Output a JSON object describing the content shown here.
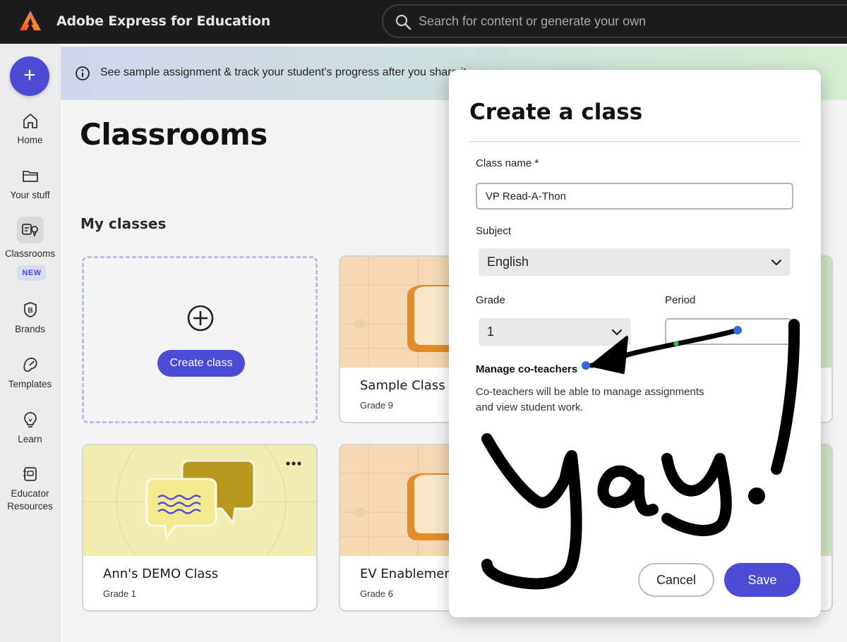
{
  "app": {
    "title": "Adobe Express for Education",
    "search_placeholder": "Search for content or generate your own"
  },
  "sidebar": {
    "create_icon": "plus-icon",
    "items": [
      {
        "label": "Home",
        "icon": "home-icon"
      },
      {
        "label": "Your stuff",
        "icon": "folder-icon"
      },
      {
        "label": "Classrooms",
        "icon": "classrooms-icon",
        "active": true
      },
      {
        "label": "Brands",
        "icon": "brand-icon"
      },
      {
        "label": "Templates",
        "icon": "templates-icon"
      },
      {
        "label": "Learn",
        "icon": "lightbulb-icon"
      },
      {
        "label": "Educator Resources",
        "icon": "resources-icon"
      }
    ],
    "new_badge": "NEW"
  },
  "banner": {
    "text": "See sample assignment & track your student's progress after you share it."
  },
  "main": {
    "title": "Classrooms",
    "section_title": "My classes",
    "create_class_label": "Create class",
    "classes": [
      {
        "name": "Sample Class - I",
        "grade": "Grade 9"
      },
      {
        "name": "Ann's DEMO Class",
        "grade": "Grade 1"
      },
      {
        "name": "EV Enablement",
        "grade": "Grade 6"
      }
    ]
  },
  "modal": {
    "title": "Create a class",
    "class_name_label": "Class name *",
    "class_name_value": "VP Read-A-Thon",
    "subject_label": "Subject",
    "subject_value": "English",
    "grade_label": "Grade",
    "grade_value": "1",
    "period_label": "Period",
    "period_value": "",
    "cot_title": "Manage co-teachers",
    "cot_desc_line1": "Co-teachers will be able to manage assignments",
    "cot_desc_line2": "and view student work.",
    "cancel_label": "Cancel",
    "save_label": "Save"
  },
  "annotation": {
    "handwriting": "yay!",
    "color": "#000000"
  },
  "colors": {
    "accent": "#4b4bd6",
    "topbar": "#1c1c1c"
  }
}
